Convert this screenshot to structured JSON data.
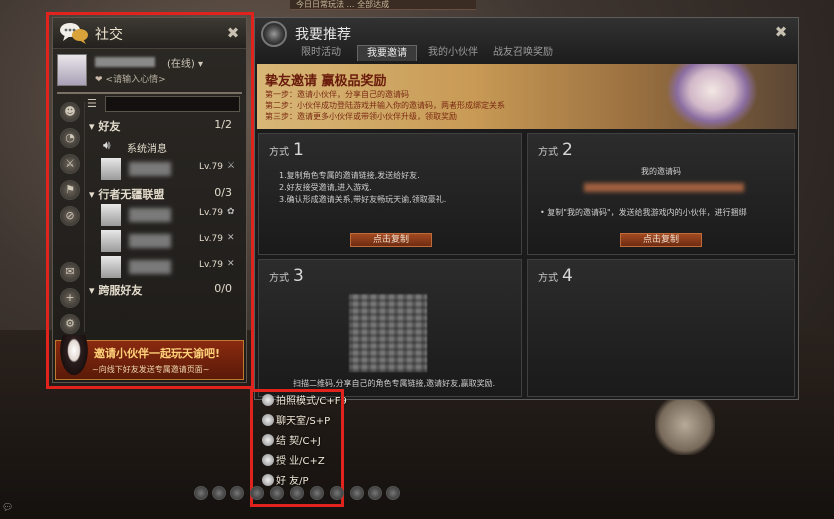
{
  "top_banner": "今日日常玩法 … 全部达成",
  "social": {
    "title": "社交",
    "status": "(在线)",
    "mood_placeholder": "<请输入心情>",
    "groups": [
      {
        "label": "好友",
        "count": "1/2"
      },
      {
        "label": "行者无疆联盟",
        "count": "0/3"
      },
      {
        "label": "跨服好友",
        "count": "0/0"
      }
    ],
    "system_message": "系统消息",
    "friends": [
      {
        "level": "Lv.79"
      },
      {
        "level": "Lv.79"
      },
      {
        "level": "Lv.79"
      },
      {
        "level": "Lv.79"
      }
    ],
    "invite": {
      "main": "邀请小伙伴一起玩天谕吧!",
      "sub": "~向线下好友发送专属邀请页面~"
    }
  },
  "recommend": {
    "title": "我要推荐",
    "tabs": [
      "限时活动",
      "我要邀请",
      "我的小伙伴",
      "战友召唤奖励"
    ],
    "active_tab": 1,
    "banner": {
      "title": "挚友邀请 赢极品奖励",
      "steps": [
        "第一步：邀请小伙伴，分享自己的邀请码",
        "第二步：小伙伴成功登陆游戏并输入你的邀请码，两者形成绑定关系",
        "第三步：邀请更多小伙伴或带领小伙伴升级，领取奖励"
      ]
    },
    "method_word": "方式",
    "cards": [
      {
        "num": "1",
        "lines": [
          "1.复制角色专属的邀请链接,发送给好友.",
          "2.好友接受邀请,进入游戏.",
          "3.确认形成邀请关系,带好友畅玩天谕,领取豪礼."
        ],
        "button": "点击复制"
      },
      {
        "num": "2",
        "code_label": "我的邀请码",
        "text": "•  复制\"我的邀请码\"，发送给我游戏内的小伙伴，进行捆绑",
        "button": "点击复制"
      },
      {
        "num": "3",
        "text": "扫描二维码,分享自己的角色专属链接,邀请好友,赢取奖励."
      },
      {
        "num": "4"
      }
    ]
  },
  "hotkeys": [
    {
      "label": "拍照模式/C+F9",
      "icon": "camera-icon"
    },
    {
      "label": "聊天室/S+P",
      "icon": "chat-bubble-icon"
    },
    {
      "label": "结 契/C+J",
      "icon": "pact-icon"
    },
    {
      "label": "授 业/C+Z",
      "icon": "mentor-icon"
    },
    {
      "label": "好 友/P",
      "icon": "friends-icon"
    }
  ]
}
